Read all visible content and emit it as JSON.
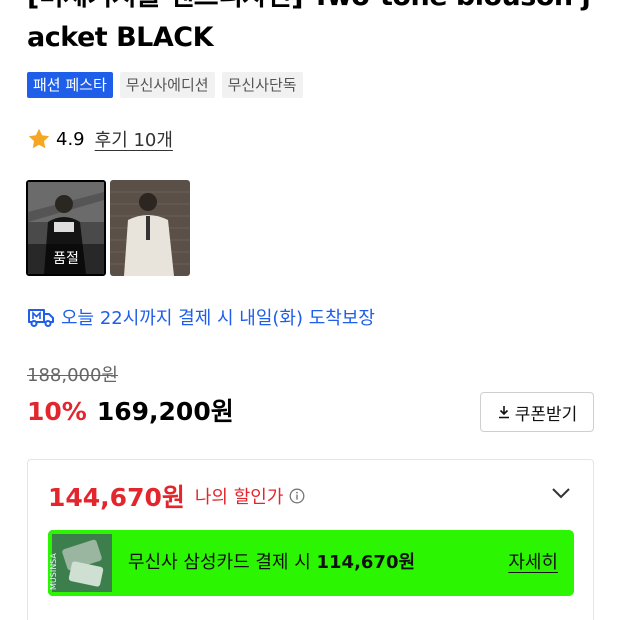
{
  "product": {
    "title_line1": "[미세기지볼 센즈디자인] Two-tone blouson j",
    "title_line2": "acket BLACK",
    "tags": [
      {
        "label": "패션 페스타",
        "highlight": true
      },
      {
        "label": "무신사에디션",
        "highlight": false
      },
      {
        "label": "무신사단독",
        "highlight": false
      }
    ]
  },
  "rating": {
    "score": "4.9",
    "reviews_label": "후기 10개",
    "star_color": "#f5a623"
  },
  "thumbnails": [
    {
      "name": "thumb-black",
      "selected": true,
      "badge": "품절"
    },
    {
      "name": "thumb-ivory",
      "selected": false,
      "badge": ""
    }
  ],
  "delivery": {
    "text": "오늘 22시까지 결제 시 내일(화) 도착보장",
    "icon": "truck-icon",
    "color": "#1f5ee8"
  },
  "pricing": {
    "original": "188,000원",
    "discount_rate": "10%",
    "sale_price": "169,200원",
    "coupon_label": "쿠폰받기"
  },
  "my_price": {
    "price": "144,670원",
    "label": "나의 할인가",
    "accent": "#e3262d"
  },
  "card_promo": {
    "text_prefix": "무신사 삼성카드 결제 시 ",
    "price": "114,670원",
    "more_label": "자세히",
    "bg_color": "#2bf500",
    "card_logo_text": "MUSINSA"
  }
}
